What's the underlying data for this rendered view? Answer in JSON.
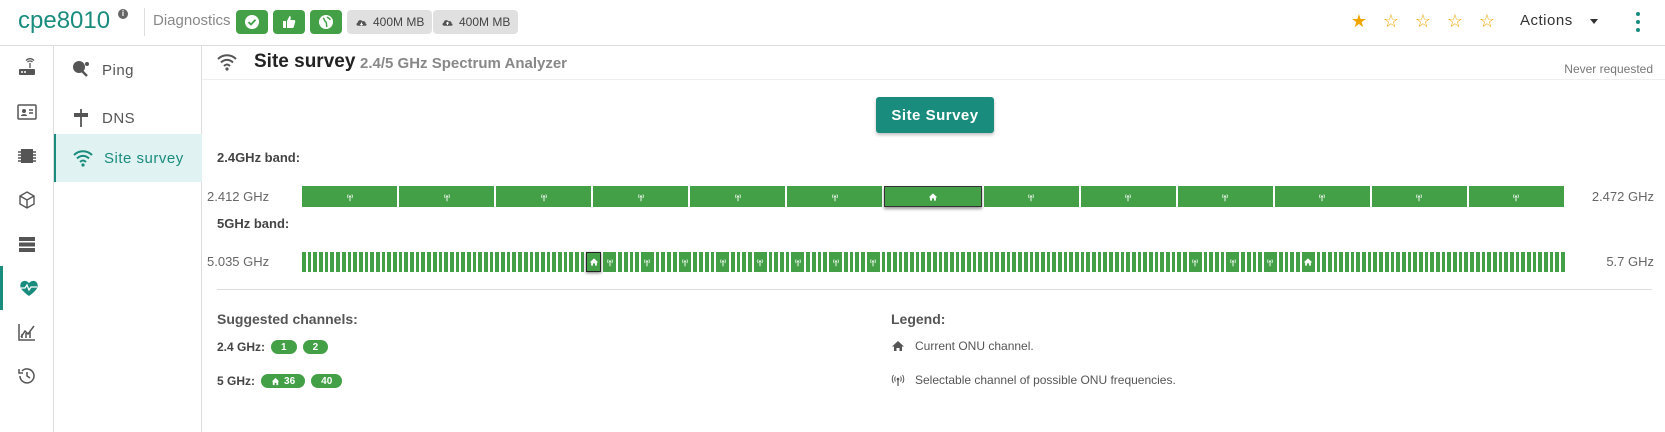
{
  "device": {
    "name": "cpe8010",
    "info_glyph": "i"
  },
  "header": {
    "section_label": "Diagnostics",
    "traffic_down": "400M MB",
    "traffic_up": "400M MB",
    "rating_filled": 1,
    "rating_total": 5,
    "actions_label": "Actions"
  },
  "subnav": {
    "items": [
      {
        "label": "Ping",
        "icon": "ping-pong-icon"
      },
      {
        "label": "DNS",
        "icon": "signpost-icon"
      },
      {
        "label": "Site survey",
        "icon": "wifi-icon"
      }
    ]
  },
  "main": {
    "title": "Site survey",
    "subtitle": "2.4/5 GHz Spectrum Analyzer",
    "status": "Never requested",
    "button_label": "Site Survey"
  },
  "band24": {
    "label": "2.4GHz band:",
    "start": "2.412 GHz",
    "end": "2.472 GHz",
    "channels": 13,
    "current_index": 6
  },
  "band5": {
    "label": "5GHz band:",
    "start": "5.035 GHz",
    "end": "5.7 GHz"
  },
  "suggested": {
    "label": "Suggested channels:",
    "ghz24_label": "2.4 GHz:",
    "ghz24": [
      "1",
      "2"
    ],
    "ghz5_label": "5 GHz:",
    "ghz5": [
      "36",
      "40"
    ]
  },
  "legend": {
    "label": "Legend:",
    "current": "Current ONU channel.",
    "selectable": "Selectable channel of possible ONU frequencies."
  },
  "colors": {
    "accent": "#1a8c7d",
    "channel": "#43a047",
    "star": "#f0a500"
  }
}
